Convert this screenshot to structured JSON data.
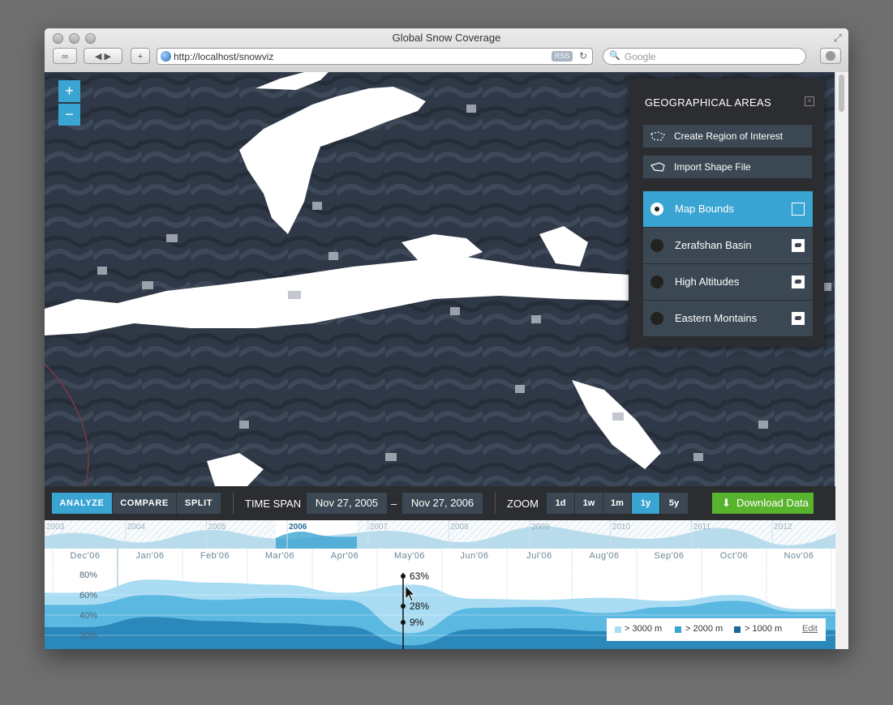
{
  "browser": {
    "title": "Global Snow Coverage",
    "url": "http://localhost/snowviz",
    "rss": "RSS",
    "search_placeholder": "Google"
  },
  "map_controls": {
    "zoom_in": "+",
    "zoom_out": "−"
  },
  "panel": {
    "title": "GEOGRAPHICAL AREAS",
    "actions": [
      "Create Region of Interest",
      "Import Shape File"
    ],
    "areas": [
      {
        "label": "Map Bounds",
        "selected": true
      },
      {
        "label": "Zerafshan Basin",
        "selected": false
      },
      {
        "label": "High Altitudes",
        "selected": false
      },
      {
        "label": "Eastern Montains",
        "selected": false
      }
    ]
  },
  "toolbar": {
    "modes": [
      "ANALYZE",
      "COMPARE",
      "SPLIT"
    ],
    "selected_mode": "ANALYZE",
    "time_span_label": "TIME SPAN",
    "start_date": "Nov 27, 2005",
    "dash": "–",
    "end_date": "Nov 27, 2006",
    "zoom_label": "ZOOM",
    "zoom_levels": [
      "1d",
      "1w",
      "1m",
      "1y",
      "5y"
    ],
    "selected_zoom": "1y",
    "download_label": "Download Data"
  },
  "timeline": {
    "years": [
      "2003",
      "2004",
      "2005",
      "2006",
      "2007",
      "2008",
      "2009",
      "2010",
      "2011",
      "2012"
    ],
    "selected_year": "2006"
  },
  "chart_data": {
    "type": "area",
    "months": [
      "Dec'06",
      "Jan'06",
      "Feb'06",
      "Mar'06",
      "Apr'06",
      "May'06",
      "Jun'06",
      "Jul'06",
      "Aug'06",
      "Sep'06",
      "Oct'06",
      "Nov'06"
    ],
    "y_ticks": [
      "80%",
      "60%",
      "40%",
      "20%"
    ],
    "ylim": [
      0,
      100
    ],
    "series": [
      {
        "name": "> 3000 m",
        "color": "#a9dcf3",
        "values": [
          62,
          75,
          72,
          70,
          62,
          70,
          56,
          55,
          57,
          54,
          60,
          46
        ]
      },
      {
        "name": "> 2000 m",
        "color": "#5bb8e0",
        "values": [
          50,
          60,
          55,
          57,
          55,
          22,
          47,
          48,
          42,
          48,
          54,
          43
        ]
      },
      {
        "name": "> 1000 m",
        "color": "#2a88bb",
        "values": [
          28,
          38,
          34,
          32,
          29,
          10,
          26,
          27,
          24,
          30,
          36,
          25
        ]
      }
    ],
    "marker": {
      "labels": [
        "63%",
        "28%",
        "9%"
      ]
    }
  },
  "legend": {
    "edit": "Edit"
  },
  "colors": {
    "accent": "#3aa4d3",
    "panel": "#2b2d31",
    "button": "#3b4853",
    "download": "#58b32d"
  }
}
